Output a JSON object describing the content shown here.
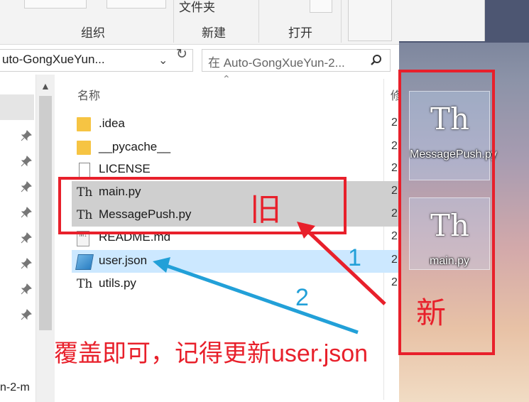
{
  "ribbon": {
    "groups": [
      "组织",
      "新建",
      "打开"
    ],
    "new_folder_label": "文件夹"
  },
  "address": {
    "path": "uto-GongXueYun...",
    "search_placeholder": "在 Auto-GongXueYun-2..."
  },
  "nav": {
    "bottom_text": "n-2-m"
  },
  "columns": {
    "name": "名称",
    "modified_partial": "修"
  },
  "files": [
    {
      "name": ".idea",
      "type": "folder",
      "date": "2"
    },
    {
      "name": "__pycache__",
      "type": "folder",
      "date": "2"
    },
    {
      "name": "LICENSE",
      "type": "file",
      "date": "2"
    },
    {
      "name": "main.py",
      "type": "py",
      "date": "2"
    },
    {
      "name": "MessagePush.py",
      "type": "py",
      "date": "2"
    },
    {
      "name": "README.md",
      "type": "md",
      "date": "2"
    },
    {
      "name": "user.json",
      "type": "json",
      "date": "2"
    },
    {
      "name": "utils.py",
      "type": "py",
      "date": "2"
    }
  ],
  "desktop_icons": [
    {
      "label": "MessagePush.py",
      "glyph": "Th"
    },
    {
      "label": "main.py",
      "glyph": "Th"
    }
  ],
  "annotations": {
    "old": "旧",
    "new": "新",
    "num1": "1",
    "num2": "2",
    "caption": "覆盖即可，记得更新user.json"
  },
  "colors": {
    "annotation_red": "#e8202b",
    "annotation_blue": "#22a0d8",
    "selected_row": "#cce8ff",
    "highlight_row": "#cfcfcf"
  }
}
